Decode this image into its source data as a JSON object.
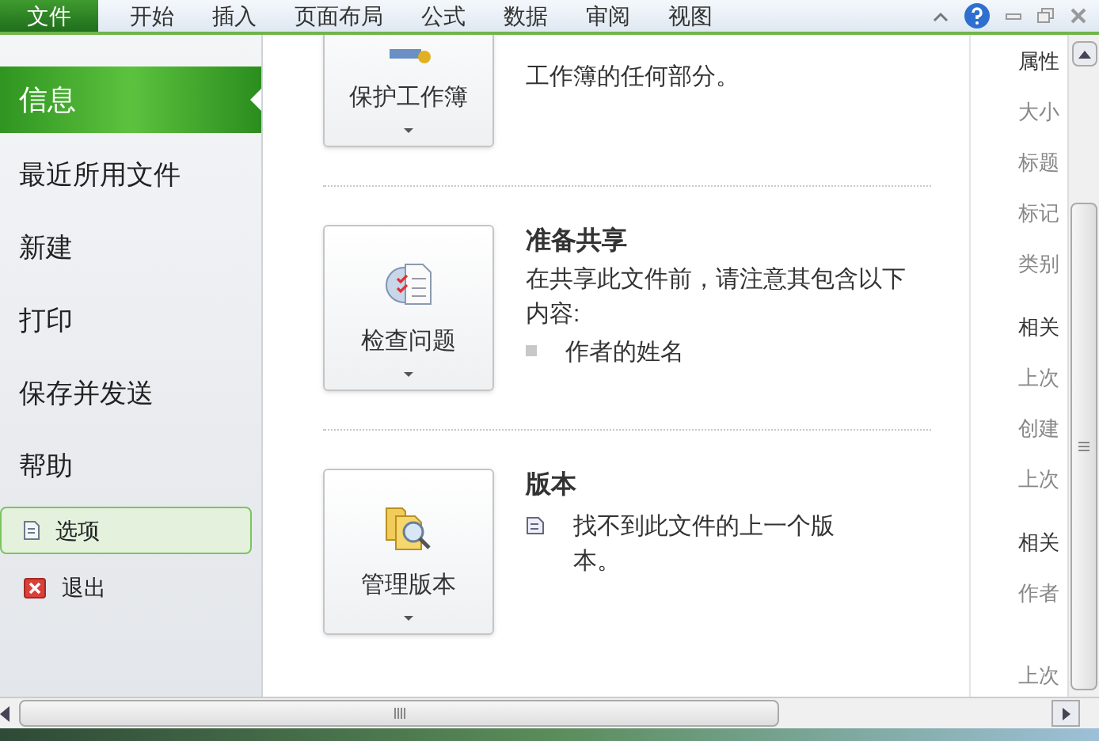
{
  "ribbon": {
    "tabs": [
      {
        "label": "文件",
        "selected": true
      },
      {
        "label": "开始",
        "selected": false
      },
      {
        "label": "插入",
        "selected": false
      },
      {
        "label": "页面布局",
        "selected": false
      },
      {
        "label": "公式",
        "selected": false
      },
      {
        "label": "数据",
        "selected": false
      },
      {
        "label": "审阅",
        "selected": false
      },
      {
        "label": "视图",
        "selected": false
      }
    ]
  },
  "sidebar": {
    "items": [
      {
        "label": "信息",
        "kind": "page",
        "selected": true
      },
      {
        "label": "最近所用文件",
        "kind": "page",
        "selected": false
      },
      {
        "label": "新建",
        "kind": "page",
        "selected": false
      },
      {
        "label": "打印",
        "kind": "page",
        "selected": false
      },
      {
        "label": "保存并发送",
        "kind": "page",
        "selected": false
      },
      {
        "label": "帮助",
        "kind": "page",
        "selected": false
      },
      {
        "label": "选项",
        "kind": "options",
        "selected": true
      },
      {
        "label": "退出",
        "kind": "exit",
        "selected": false
      }
    ]
  },
  "sections": [
    {
      "button": "保护工作簿",
      "kind": "protect",
      "lines": [
        "工作簿的任何部分。"
      ]
    },
    {
      "button": "检查问题",
      "kind": "inspect",
      "title": "准备共享",
      "lines": [
        "在共享此文件前，请注意其包含以下内容:"
      ],
      "bullets": [
        "作者的姓名"
      ]
    },
    {
      "button": "管理版本",
      "kind": "versions",
      "title": "版本",
      "bullets": [
        "找不到此文件的上一个版本。"
      ]
    }
  ],
  "properties": [
    {
      "label": "属性",
      "kind": "heading"
    },
    {
      "label": "大小",
      "kind": "field"
    },
    {
      "label": "标题",
      "kind": "field"
    },
    {
      "label": "标记",
      "kind": "field"
    },
    {
      "label": "类别",
      "kind": "field"
    },
    {
      "label": "相关",
      "kind": "heading"
    },
    {
      "label": "上次",
      "kind": "field"
    },
    {
      "label": "创建",
      "kind": "field"
    },
    {
      "label": "上次",
      "kind": "field"
    },
    {
      "label": "相关",
      "kind": "heading"
    },
    {
      "label": "作者",
      "kind": "field"
    },
    {
      "label": "上次",
      "kind": "gapfield"
    }
  ]
}
